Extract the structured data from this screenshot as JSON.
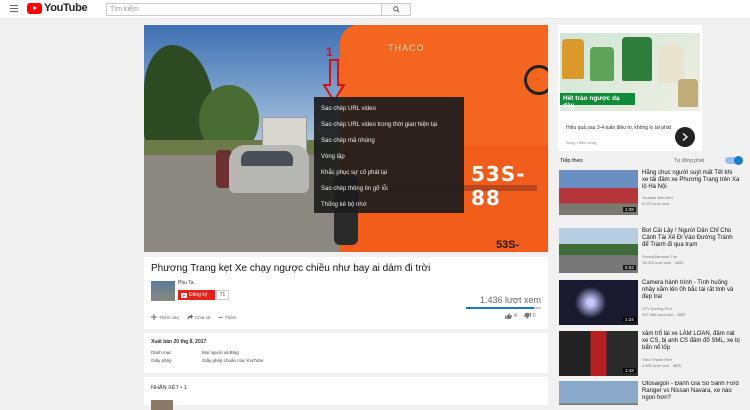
{
  "masthead": {
    "logo_text": "YouTube",
    "logo_region": "VN",
    "search_placeholder": "Tìm kiếm"
  },
  "player": {
    "bus_brand": "THACO",
    "bus_plate": "53S-88",
    "bus_plate_lower": "53S-",
    "annotation_number": "1",
    "context_menu": [
      "Sao chép URL video",
      "Sao chép URL video trong thời gian hiện tại",
      "Sao chép mã nhúng",
      "Vòng lặp",
      "Khắc phục sự cố phát lại",
      "Sao chép thông tin gỡ lỗi",
      "Thống kê bộ nhớ"
    ]
  },
  "video": {
    "title": "Phương Trang kẹt Xe chạy ngược chiều như bay ai dám đi trời",
    "channel": "Phu Ta",
    "subscribe_label": "Đăng ký",
    "subscriber_count": "71",
    "view_count": "1.436 lượt xem",
    "like_ratio": 0.9,
    "actions": [
      "Thêm vào",
      "Chia sẻ",
      "Thêm"
    ],
    "likes": "4",
    "dislikes": "0"
  },
  "description": {
    "published": "Xuất bản 20 thg 8, 2017",
    "rows": [
      {
        "label": "Danh mục",
        "value": "Mọi người và Blog"
      },
      {
        "label": "Giấy phép",
        "value": "Giấy phép chuẩn của YouTube"
      }
    ]
  },
  "comments": {
    "header": "NHẬN XÉT • 1"
  },
  "ad": {
    "banner": "Hết trào ngược dạ dày",
    "text": "Hiệu quả sau 3-4 tuần điều trị, không lo tái phát",
    "source": "Sống • Bền vững"
  },
  "up_next": {
    "label": "Tiếp theo",
    "autoplay_label": "Tự động phát",
    "autoplay_on": true,
    "items": [
      {
        "title": "Hãng chục người suýt mất Tết khi xe tải đâm xe Phương Trang trên Xa lộ Hà Nội",
        "channel": "Youtube Bản Mới",
        "views": "6.574 lượt xem",
        "duration": "1:39",
        "badge": ""
      },
      {
        "title": "Bơi Cái Lậy ! Người Dân Chỉ Cho Cảnh Tài Xế Đi Vào Đường Tránh để Tránh đi qua trạm",
        "channel": "SunnyDiamond The",
        "views": "15.913 lượt xem",
        "duration": "5:52",
        "badge": "MỚI"
      },
      {
        "title": "Camera hành trình - Tình huống nhảy xăm lên 0h bắc tài rất tinh và đẹp trai",
        "channel": "VTV Đường Phố",
        "views": "297.086 lượt xem",
        "duration": "1:24",
        "badge": "MỚI"
      },
      {
        "title": "xâm trổ lái xe LÀM LOAN, đâm nát xe CS, bị anh CS đâm đổ SML, xe bị bẩn nổ lốp",
        "channel": "Triều Thành Heh",
        "views": "4.832 lượt xem",
        "duration": "1:43",
        "badge": "MỚI"
      },
      {
        "title": "Otosaigon - Đánh Giá So Sánh Ford Ranger vs Nissan Navara, xe nào ngon hơn?",
        "channel": "",
        "views": "",
        "duration": "",
        "badge": ""
      }
    ]
  }
}
